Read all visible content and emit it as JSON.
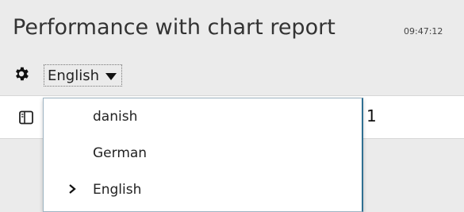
{
  "header": {
    "title": "Performance with chart report",
    "timestamp": "09:47:12"
  },
  "toolbar": {
    "settings_icon": "gear-icon",
    "language_selected": "English"
  },
  "row": {
    "icon": "book-icon",
    "tail_text": "1"
  },
  "language_menu": {
    "items": [
      {
        "label": "danish",
        "selected": false
      },
      {
        "label": "German",
        "selected": false
      },
      {
        "label": "English",
        "selected": true
      }
    ]
  }
}
